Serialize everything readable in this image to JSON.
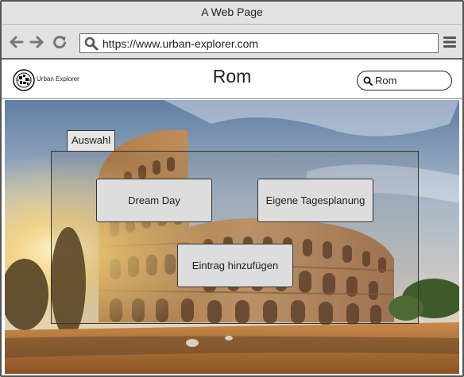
{
  "window": {
    "title": "A Web Page"
  },
  "browser": {
    "url": "https://www.urban-explorer.com",
    "icons": [
      "arrow-left-icon",
      "arrow-right-icon",
      "reload-icon",
      "search-icon",
      "hamburger-menu-icon"
    ]
  },
  "header": {
    "logo_text": "Urban Explorer",
    "title": "Rom",
    "search_value": "Rom"
  },
  "panel": {
    "tab_label": "Auswahl",
    "buttons": {
      "dream_day": "Dream Day",
      "own_plan": "Eigene Tagesplanung",
      "add_entry": "Eintrag hinzufügen"
    }
  },
  "colors": {
    "chrome": "#e2e2e2",
    "button": "#dddddd",
    "border": "#333333"
  }
}
